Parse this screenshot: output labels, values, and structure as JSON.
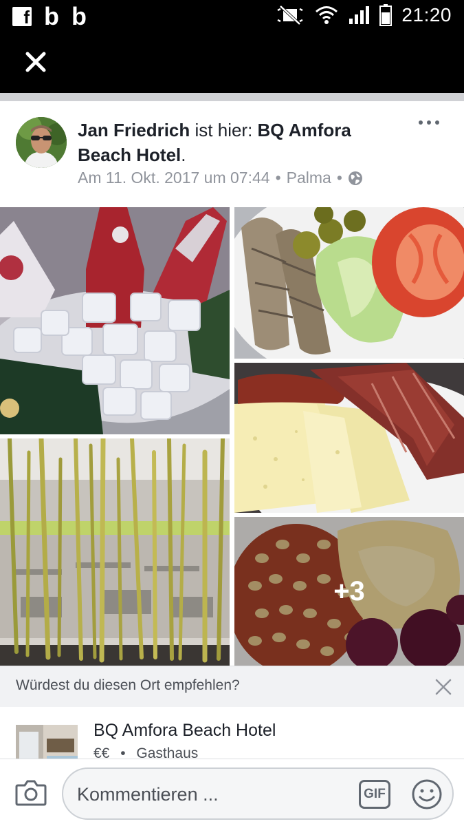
{
  "status_bar": {
    "left_icons": [
      "facebook-icon",
      "b-app-icon",
      "b-app-icon"
    ],
    "right_icons": [
      "mute-icon",
      "wifi-icon",
      "signal-icon",
      "battery-icon"
    ],
    "time": "21:20"
  },
  "header": {
    "close_icon": "close-icon"
  },
  "post": {
    "author": "Jan Friedrich",
    "action": " ist hier: ",
    "place": "BQ Amfora Beach Hotel",
    "period": ".",
    "date": "Am 11. Okt. 2017 um 07:44",
    "separator": "•",
    "location": "Palma",
    "privacy_icon": "globe-icon",
    "more_icon": "more-options-icon",
    "photos": [
      {
        "subject": "champagne-in-ice-bucket"
      },
      {
        "subject": "sardines-salad-plate"
      },
      {
        "subject": "cheese-ham-sausage-plate"
      },
      {
        "subject": "bamboo-restaurant-interior"
      },
      {
        "subject": "beans-eggs-plate",
        "overlay": "+3"
      }
    ]
  },
  "recommend": {
    "question": "Würdest du diesen Ort empfehlen?",
    "close_icon": "close-icon"
  },
  "place_card": {
    "name": "BQ Amfora Beach Hotel",
    "price": "€€",
    "category": "Gasthaus"
  },
  "comment_bar": {
    "camera_icon": "camera-icon",
    "placeholder": "Kommentieren ...",
    "gif_label": "GIF",
    "emoji_icon": "smiley-icon"
  },
  "colors": {
    "status_bar_bg": "#000000",
    "text_primary": "#1d2129",
    "text_secondary": "#90949c"
  }
}
